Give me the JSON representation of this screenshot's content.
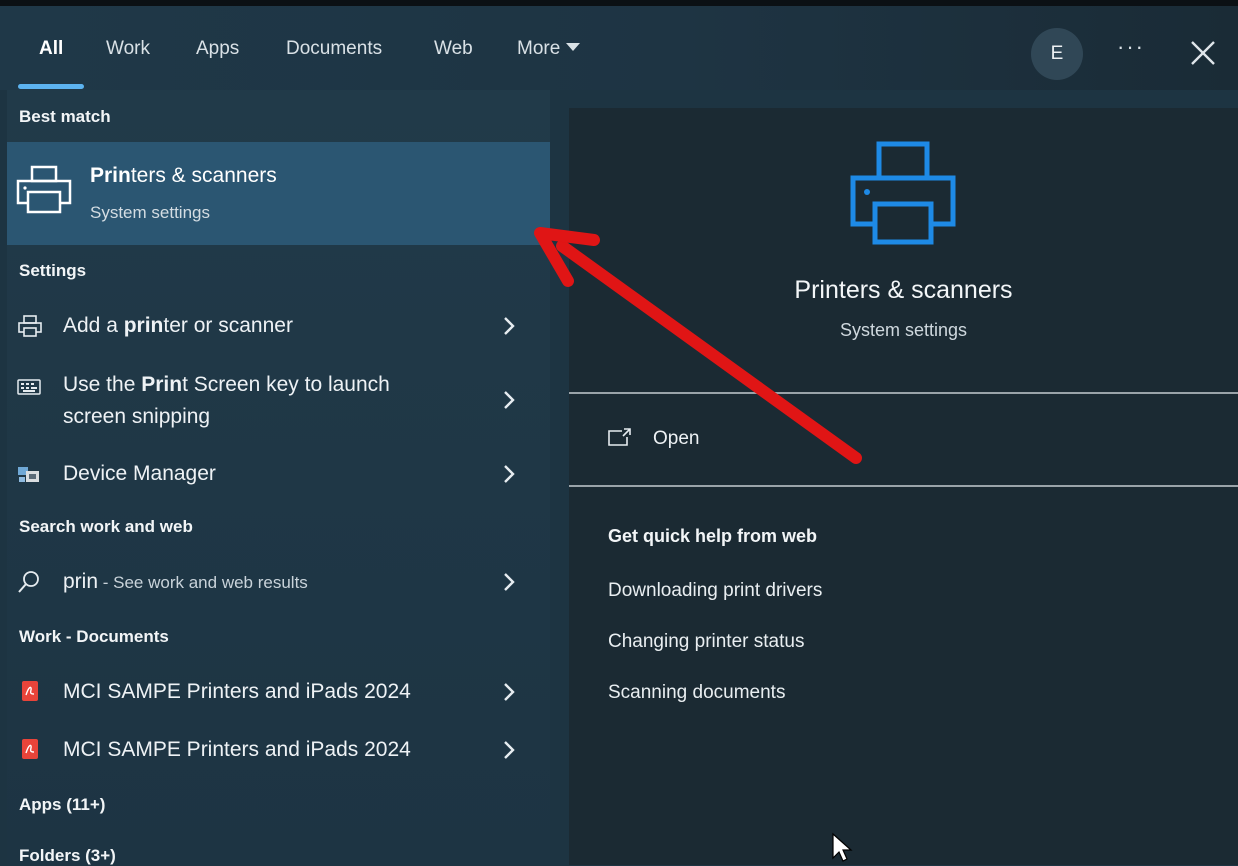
{
  "tabs": [
    {
      "label": "All"
    },
    {
      "label": "Work"
    },
    {
      "label": "Apps"
    },
    {
      "label": "Documents"
    },
    {
      "label": "Web"
    },
    {
      "label": "More"
    }
  ],
  "avatar_initial": "E",
  "more_options_label": "···",
  "sections": {
    "best_match": "Best match",
    "settings": "Settings",
    "search_web": "Search work and web",
    "work_docs": "Work - Documents",
    "apps": "Apps (11+)",
    "folders": "Folders (3+)"
  },
  "best_match": {
    "title_bold": "Prin",
    "title_rest": "ters & scanners",
    "subtitle": "System settings",
    "icon": "printer-icon"
  },
  "settings_items": [
    {
      "pre": "Add a ",
      "bold": "prin",
      "post": "ter or scanner",
      "icon": "printer-icon"
    },
    {
      "pre": "Use the ",
      "bold": "Prin",
      "post": "t Screen key to launch",
      "line2": "screen snipping",
      "icon": "keyboard-icon"
    },
    {
      "pre": "Device Manager",
      "bold": "",
      "post": "",
      "icon": "device-manager-icon"
    }
  ],
  "web_search": {
    "query": "prin",
    "suffix": " - See work and web results",
    "icon": "search-icon"
  },
  "documents": [
    {
      "label": "MCI SAMPE Printers and iPads 2024",
      "icon": "pdf-icon"
    },
    {
      "label": "MCI SAMPE Printers and iPads 2024",
      "icon": "pdf-icon"
    }
  ],
  "preview": {
    "title": "Printers & scanners",
    "subtitle": "System settings",
    "open_label": "Open",
    "help_header": "Get quick help from web",
    "help_links": [
      "Downloading print drivers",
      "Changing printer status",
      "Scanning documents"
    ]
  },
  "colors": {
    "accent": "#5cb3f0",
    "selected_bg": "#2b5672",
    "arrow": "#e01515",
    "pdf_red": "#e8443a"
  }
}
